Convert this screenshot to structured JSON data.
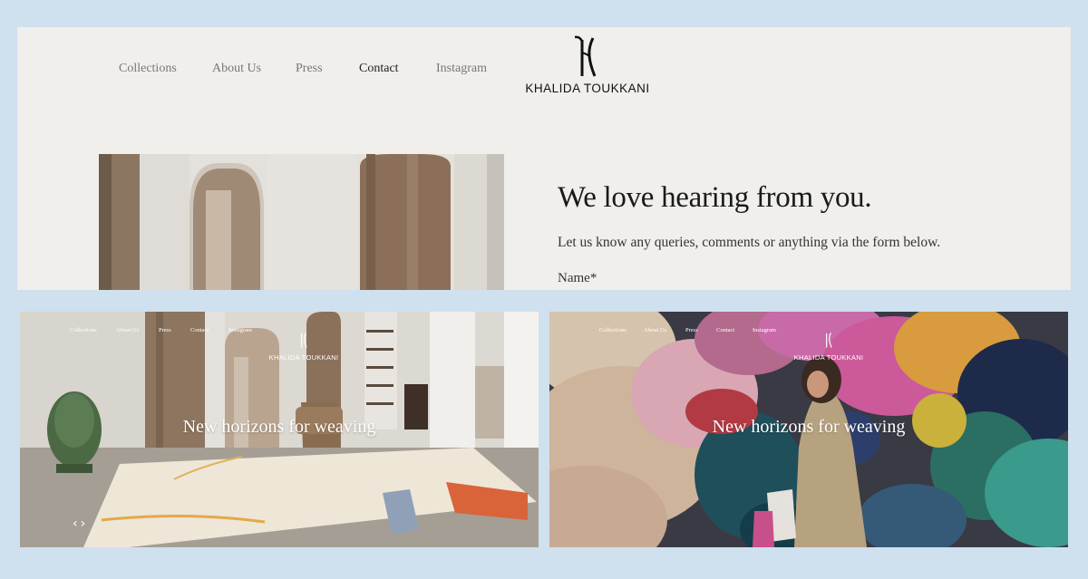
{
  "header": {
    "nav": [
      "Collections",
      "About Us",
      "Press",
      "Contact",
      "Instagram"
    ],
    "active": "Contact",
    "brand": "KHALIDA TOUKKANI"
  },
  "contact": {
    "title": "We love hearing from you.",
    "subtitle": "Let us know any queries, comments or anything via the form below.",
    "name_label": "Name*"
  },
  "slides": [
    {
      "nav": [
        "Collections",
        "About Us",
        "Press",
        "Contact",
        "Instagram"
      ],
      "brand": "KHALIDA TOUKKANI",
      "headline": "New horizons for weaving",
      "arrows": "‹ ›"
    },
    {
      "nav": [
        "Collections",
        "About Us",
        "Press",
        "Contact",
        "Instagram"
      ],
      "brand": "KHALIDA TOUKKANI",
      "headline": "New horizons for weaving"
    }
  ],
  "colors": {
    "page_bg": "#cfe0ef",
    "panel_bg": "#f0efeb",
    "text_dark": "#1a1a1a",
    "nav_text": "#777777"
  },
  "icons": [
    "brand-monogram-icon",
    "chevron-left-icon",
    "chevron-right-icon"
  ]
}
